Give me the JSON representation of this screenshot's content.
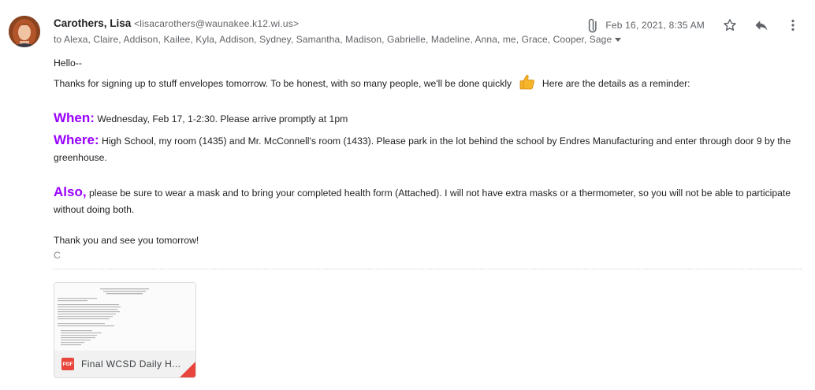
{
  "sender": {
    "name": "Carothers, Lisa",
    "email": "<lisacarothers@waunakee.k12.wi.us>"
  },
  "recipients": "to Alexa, Claire, Addison, Kailee, Kyla, Addison, Sydney, Samantha, Madison, Gabrielle, Madeline, Anna, me, Grace, Cooper, Sage",
  "date": "Feb 16, 2021, 8:35 AM",
  "icons": [
    "attachment-icon",
    "star-icon",
    "reply-icon",
    "more-vert-icon",
    "thumbs-up-icon",
    "pdf-icon"
  ],
  "body": {
    "greeting": "Hello--",
    "line1a": "Thanks for signing up to stuff envelopes tomorrow. To be honest, with so many people, we'll be done quickly",
    "line1b": "Here are the details as a reminder:",
    "when_label": "When:",
    "when_text": "Wednesday, Feb 17, 1-2:30. Please arrive promptly at 1pm",
    "where_label": "Where:",
    "where_text": "High School, my room (1435) and Mr. McConnell's room (1433). Please park in the lot behind the school by Endres Manufacturing and enter through door 9 by the greenhouse.",
    "also_label": "Also,",
    "also_text": "please be sure to wear a mask and to bring your completed health form (Attached). I will not have extra masks or a thermometer, so you will not be able to participate without doing both.",
    "closing": "Thank you and see you tomorrow!",
    "signature": "C"
  },
  "attachment": {
    "type_label": "PDF",
    "name": "Final WCSD Daily H..."
  },
  "colors": {
    "keyword": "#9900ff",
    "pdf_red": "#e8453c",
    "meta_gray": "#5f6368"
  }
}
